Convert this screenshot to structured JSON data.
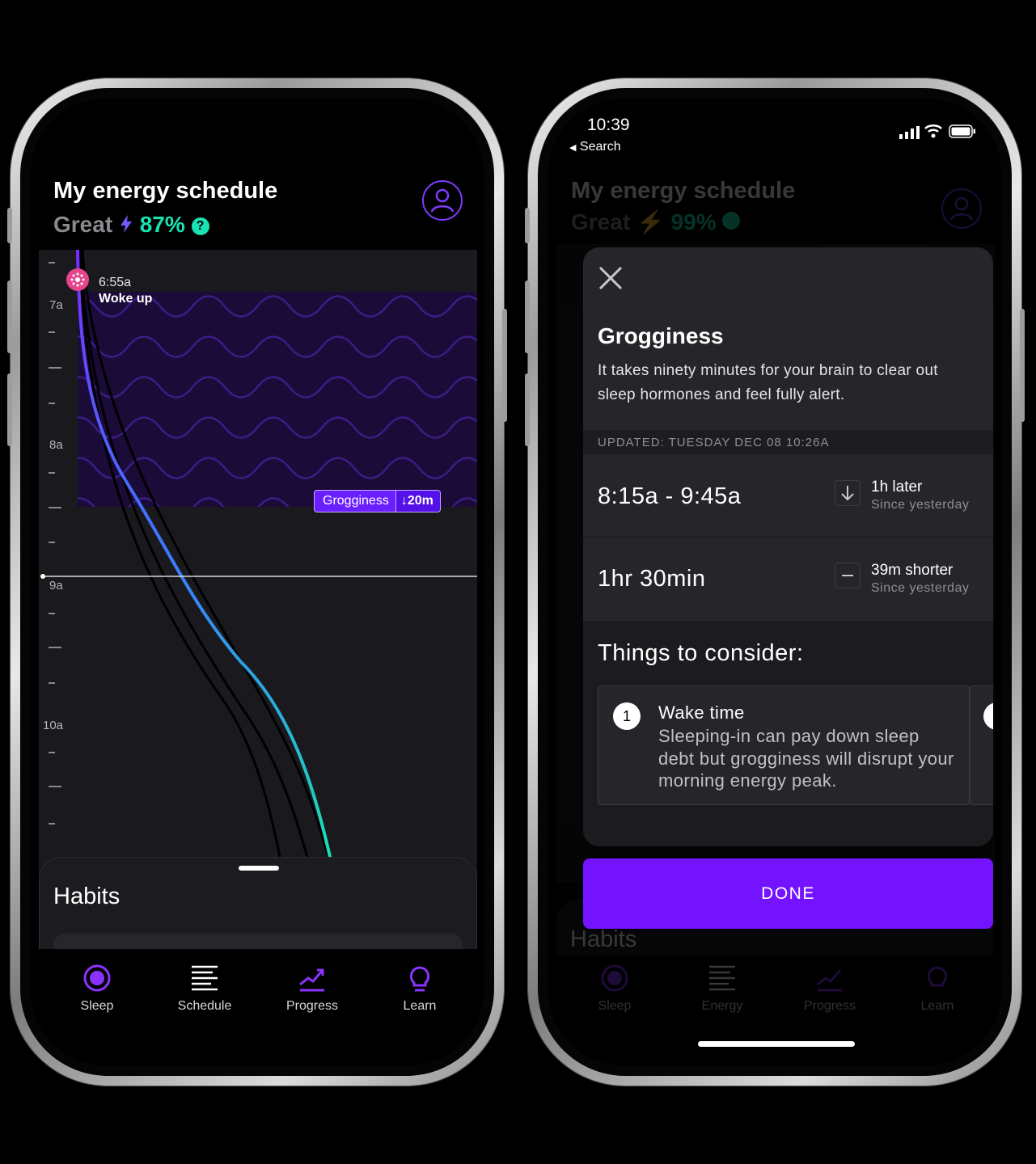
{
  "left": {
    "title": "My energy schedule",
    "status": {
      "label": "Great",
      "percent": "87%"
    },
    "chart": {
      "hour_labels": [
        "7a",
        "8a",
        "9a",
        "10a"
      ],
      "wake": {
        "time": "6:55a",
        "label": "Woke up"
      },
      "period": {
        "label": "Grogginess",
        "delta": "20m"
      }
    },
    "habits_title": "Habits",
    "tabs": [
      "Sleep",
      "Schedule",
      "Progress",
      "Learn"
    ]
  },
  "right": {
    "status_bar": {
      "time": "10:39",
      "back_label": "Search"
    },
    "bg": {
      "title": "My energy schedule",
      "status": {
        "label": "Great",
        "percent": "99%"
      },
      "habits_title": "Habits",
      "tabs": [
        "Sleep",
        "Energy",
        "Progress",
        "Learn"
      ]
    },
    "modal": {
      "title": "Grogginess",
      "description": "It takes ninety minutes for your brain to clear out sleep hormones and feel fully alert.",
      "updated": "UPDATED: TUESDAY DEC 08 10:26A",
      "rows": [
        {
          "value": "8:15a - 9:45a",
          "change": "1h later",
          "since": "Since yesterday",
          "icon": "arrow-down-icon"
        },
        {
          "value": "1hr 30min",
          "change": "39m shorter",
          "since": "Since yesterday",
          "icon": "minus-icon"
        }
      ],
      "consider_title": "Things to consider:",
      "consider": [
        {
          "number": "1",
          "title": "Wake time",
          "text": "Sleeping-in can pay down sleep debt but grogginess will disrupt your morning energy peak."
        }
      ]
    },
    "done_label": "DONE"
  },
  "colors": {
    "accent": "#7313ff",
    "teal": "#19e2b3",
    "purple_ring": "#7b3cff",
    "wake_dot": "#e5458d"
  }
}
